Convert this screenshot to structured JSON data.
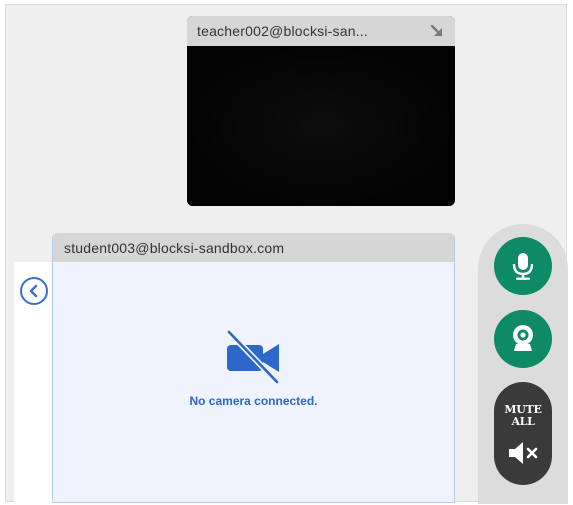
{
  "teacher_tile": {
    "name": "teacher002@blocksi-san...",
    "expand_icon": "expand-arrow-icon"
  },
  "student_tile": {
    "name": "student003@blocksi-sandbox.com",
    "status_text": "No camera connected.",
    "status_icon": "camera-off-icon"
  },
  "collapse_icon": "chevron-left-icon",
  "controls": {
    "mic_icon": "microphone-icon",
    "camera_icon": "webcam-icon",
    "mute_all_label": "MUTE ALL",
    "mute_icon": "speaker-muted-icon"
  },
  "colors": {
    "control_green": "#0e8a66",
    "accent_blue": "#2d67c8",
    "mute_button": "#3a3a3a"
  }
}
